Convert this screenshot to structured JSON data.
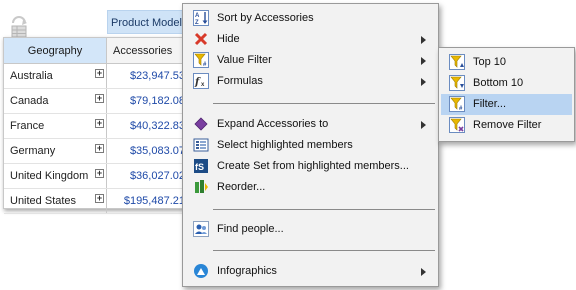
{
  "pivot": {
    "column_header": "Product Model C",
    "row_header": "Geography",
    "measure_header": "Accessories",
    "rows": [
      {
        "label": "Australia",
        "value": "$23,947.53"
      },
      {
        "label": "Canada",
        "value": "$79,182.08"
      },
      {
        "label": "France",
        "value": "$40,322.83"
      },
      {
        "label": "Germany",
        "value": "$35,083.07"
      },
      {
        "label": "United Kingdom",
        "value": "$36,027.02"
      },
      {
        "label": "United States",
        "value": "$195,487.21"
      }
    ],
    "expand_glyph": "+"
  },
  "menu": {
    "items": [
      {
        "label": "Sort by Accessories",
        "icon": "sort-icon",
        "submenu": false
      },
      {
        "label": "Hide",
        "icon": "hide-icon",
        "submenu": true
      },
      {
        "label": "Value Filter",
        "icon": "value-filter-icon",
        "submenu": true
      },
      {
        "label": "Formulas",
        "icon": "formulas-icon",
        "submenu": true
      },
      {
        "label": "Expand Accessories to",
        "icon": "expand-icon",
        "submenu": true
      },
      {
        "label": "Select highlighted members",
        "icon": "select-members-icon",
        "submenu": false
      },
      {
        "label": "Create Set from highlighted members...",
        "icon": "create-set-icon",
        "submenu": false
      },
      {
        "label": "Reorder...",
        "icon": "reorder-icon",
        "submenu": false
      },
      {
        "label": "Find people...",
        "icon": "find-people-icon",
        "submenu": false
      },
      {
        "label": "Infographics",
        "icon": "infographics-icon",
        "submenu": true
      }
    ]
  },
  "submenu": {
    "items": [
      {
        "label": "Top 10",
        "icon": "top-10-icon"
      },
      {
        "label": "Bottom 10",
        "icon": "bottom-10-icon"
      },
      {
        "label": "Filter...",
        "icon": "filter-icon",
        "highlighted": true
      },
      {
        "label": "Remove Filter",
        "icon": "remove-filter-icon"
      }
    ]
  },
  "colors": {
    "header_blue": "#cfe3f7",
    "value_blue": "#1f4aa8",
    "highlight": "#b9d4f2",
    "hide_red": "#d83a2a",
    "filter_yellow": "#e8b800"
  }
}
